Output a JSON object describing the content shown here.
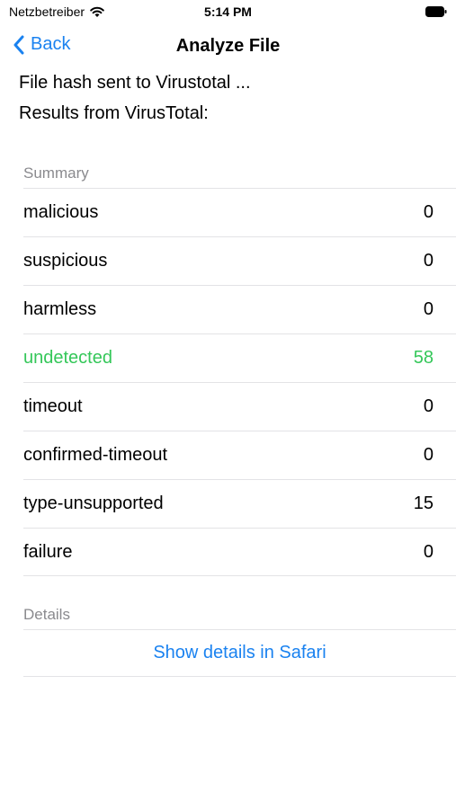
{
  "status_bar": {
    "carrier": "Netzbetreiber",
    "time": "5:14 PM",
    "wifi_icon": "wifi-icon",
    "battery_icon": "battery-icon"
  },
  "nav": {
    "back_label": "Back",
    "back_icon": "chevron-left-icon",
    "title": "Analyze File"
  },
  "info": {
    "line1": "File hash sent to Virustotal ...",
    "line2": "Results from VirusTotal:"
  },
  "summary": {
    "header": "Summary",
    "rows": [
      {
        "label": "malicious",
        "value": "0"
      },
      {
        "label": "suspicious",
        "value": "0"
      },
      {
        "label": "harmless",
        "value": "0"
      },
      {
        "label": "undetected",
        "value": "58"
      },
      {
        "label": "timeout",
        "value": "0"
      },
      {
        "label": "confirmed-timeout",
        "value": "0"
      },
      {
        "label": "type-unsupported",
        "value": "15"
      },
      {
        "label": "failure",
        "value": "0"
      }
    ]
  },
  "details": {
    "header": "Details",
    "button_label": "Show details in Safari"
  },
  "colors": {
    "accent": "#1a82f0",
    "highlight_green": "#34c759",
    "section_header": "#8a8a8e"
  }
}
